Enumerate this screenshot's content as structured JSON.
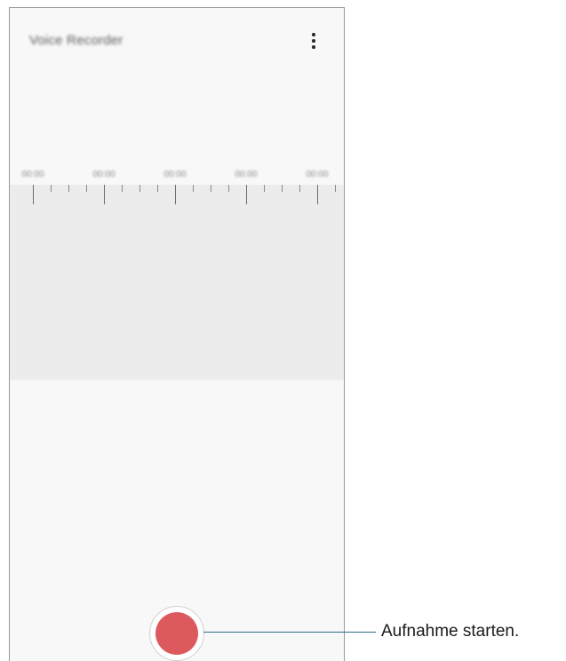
{
  "app": {
    "title": "Voice Recorder",
    "more_icon": "more-vert-icon"
  },
  "timeline": {
    "labels": [
      "00:00",
      "00:00",
      "00:00",
      "00:00",
      "00:00"
    ]
  },
  "record_button": {
    "icon": "record-icon",
    "color": "#dc5a5e"
  },
  "callout": {
    "text": "Aufnahme starten."
  }
}
